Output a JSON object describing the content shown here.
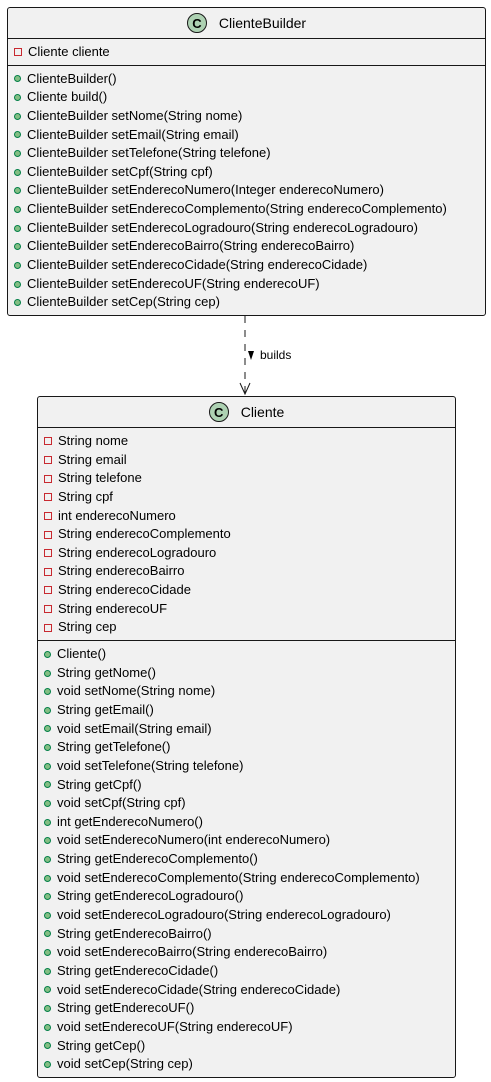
{
  "builder": {
    "icon_letter": "C",
    "name": "ClienteBuilder",
    "attributes": [
      "Cliente cliente"
    ],
    "methods": [
      "ClienteBuilder()",
      "Cliente build()",
      "ClienteBuilder setNome(String nome)",
      "ClienteBuilder setEmail(String email)",
      "ClienteBuilder setTelefone(String telefone)",
      "ClienteBuilder setCpf(String cpf)",
      "ClienteBuilder setEnderecoNumero(Integer enderecoNumero)",
      "ClienteBuilder setEnderecoComplemento(String enderecoComplemento)",
      "ClienteBuilder setEnderecoLogradouro(String enderecoLogradouro)",
      "ClienteBuilder setEnderecoBairro(String enderecoBairro)",
      "ClienteBuilder setEnderecoCidade(String enderecoCidade)",
      "ClienteBuilder setEnderecoUF(String enderecoUF)",
      "ClienteBuilder setCep(String cep)"
    ]
  },
  "relation": {
    "label": "builds",
    "style": "dashed-dependency"
  },
  "cliente": {
    "icon_letter": "C",
    "name": "Cliente",
    "attributes": [
      "String nome",
      "String email",
      "String telefone",
      "String cpf",
      "int enderecoNumero",
      "String enderecoComplemento",
      "String enderecoLogradouro",
      "String enderecoBairro",
      "String enderecoCidade",
      "String enderecoUF",
      "String cep"
    ],
    "methods": [
      "Cliente()",
      "String getNome()",
      "void setNome(String nome)",
      "String getEmail()",
      "void setEmail(String email)",
      "String getTelefone()",
      "void setTelefone(String telefone)",
      "String getCpf()",
      "void setCpf(String cpf)",
      "int getEnderecoNumero()",
      "void setEnderecoNumero(int enderecoNumero)",
      "String getEnderecoComplemento()",
      "void setEnderecoComplemento(String enderecoComplemento)",
      "String getEnderecoLogradouro()",
      "void setEnderecoLogradouro(String enderecoLogradouro)",
      "String getEnderecoBairro()",
      "void setEnderecoBairro(String enderecoBairro)",
      "String getEnderecoCidade()",
      "void setEnderecoCidade(String enderecoCidade)",
      "String getEnderecoUF()",
      "void setEnderecoUF(String enderecoUF)",
      "String getCep()",
      "void setCep(String cep)"
    ]
  },
  "colors": {
    "class_bg": "#F1F1F1",
    "class_icon": "#ADD1B2",
    "private": "#C82930",
    "public": "#84BE84"
  }
}
